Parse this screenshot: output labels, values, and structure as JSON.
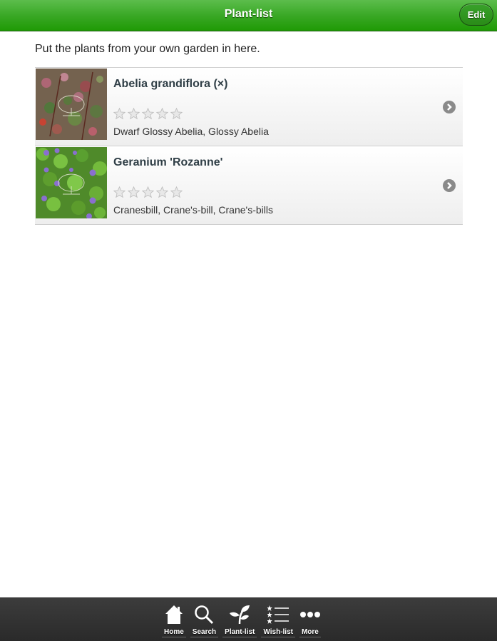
{
  "header": {
    "title": "Plant-list",
    "edit_label": "Edit",
    "accent_color": "#2da017"
  },
  "intro_text": "Put the plants from your own garden in here.",
  "plants": [
    {
      "name": "Abelia grandiflora (×)",
      "rating": 0,
      "rating_max": 5,
      "common_names": "Dwarf Glossy Abelia, Glossy Abelia",
      "thumbnail": "abelia-photo"
    },
    {
      "name": "Geranium 'Rozanne'",
      "rating": 0,
      "rating_max": 5,
      "common_names": "Cranesbill, Crane's-bill, Crane's-bills",
      "thumbnail": "geranium-photo"
    }
  ],
  "footer": {
    "nav": [
      {
        "label": "Home",
        "icon": "home-icon"
      },
      {
        "label": "Search",
        "icon": "search-icon"
      },
      {
        "label": "Plant-list",
        "icon": "plant-icon"
      },
      {
        "label": "Wish-list",
        "icon": "wish-list-icon"
      },
      {
        "label": "More",
        "icon": "more-icon"
      }
    ]
  }
}
